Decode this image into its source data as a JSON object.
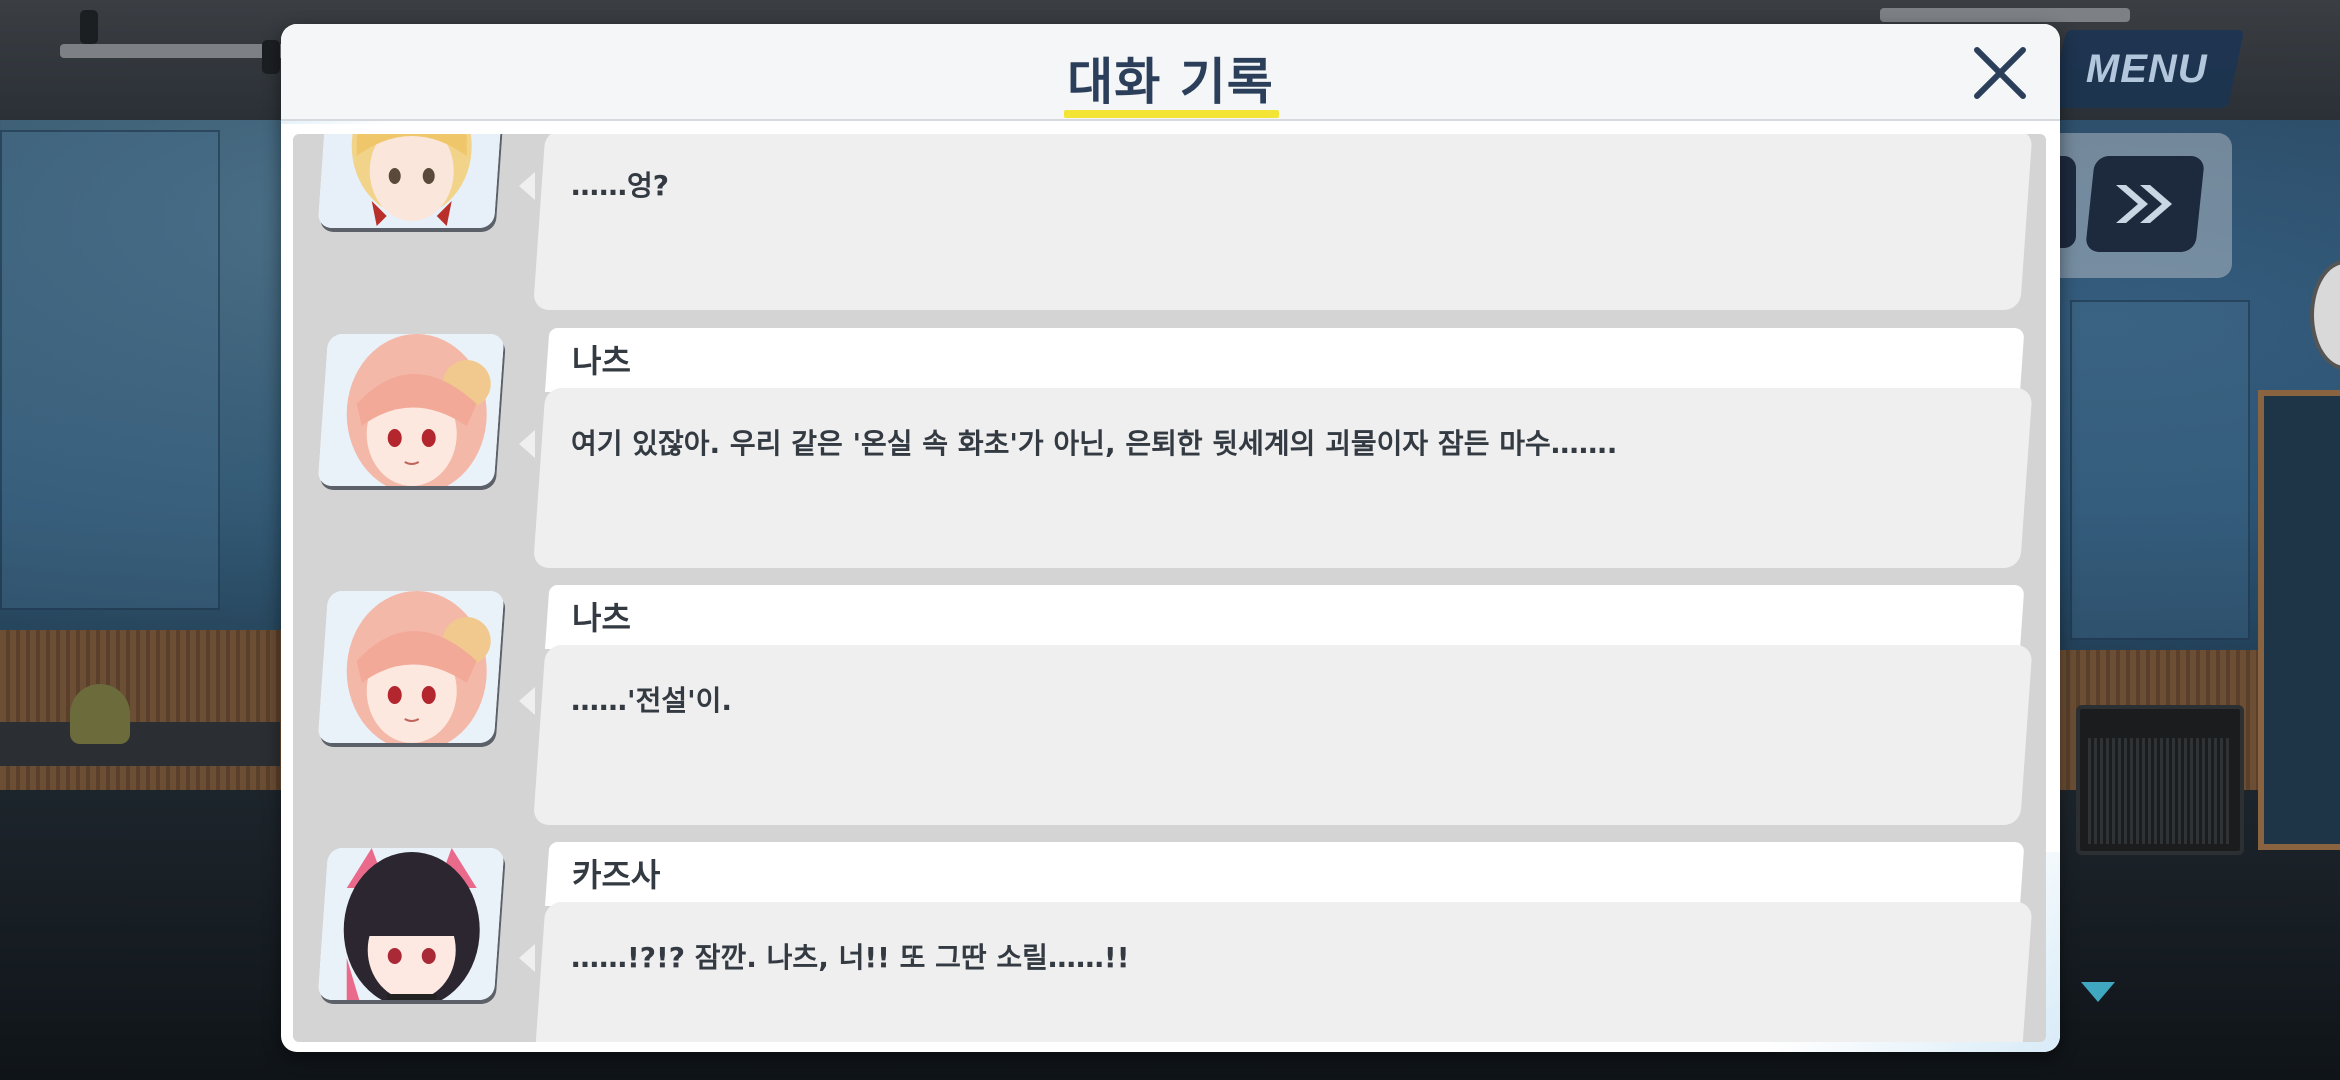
{
  "dialog": {
    "title": "대화 기록",
    "close_icon": "close-icon"
  },
  "controls": {
    "menu_label": "MENU",
    "skip_icon": "fast-forward-icon",
    "scroll_indicator_icon": "triangle-down-icon"
  },
  "log": [
    {
      "speaker": "",
      "portrait": "portrait-blonde-girl",
      "text": "……엉?"
    },
    {
      "speaker": "나츠",
      "portrait": "portrait-natsu",
      "text": "여기 있잖아. 우리 같은 '온실 속 화초'가 아닌, 은퇴한 뒷세계의 괴물이자 잠든 마수……."
    },
    {
      "speaker": "나츠",
      "portrait": "portrait-natsu",
      "text": "……'전설'이."
    },
    {
      "speaker": "카즈사",
      "portrait": "portrait-kazusa",
      "text": "……!?!? 잠깐. 나츠, 너!! 또 그딴 소릴……!!"
    }
  ],
  "colors": {
    "title": "#2b3f5a",
    "title_underline": "#f4e436",
    "list_background": "#d4d4d4",
    "bubble": "#efefef",
    "name_bar": "#ffffff",
    "text": "#333a42",
    "menu_bg": "#1c3452"
  }
}
